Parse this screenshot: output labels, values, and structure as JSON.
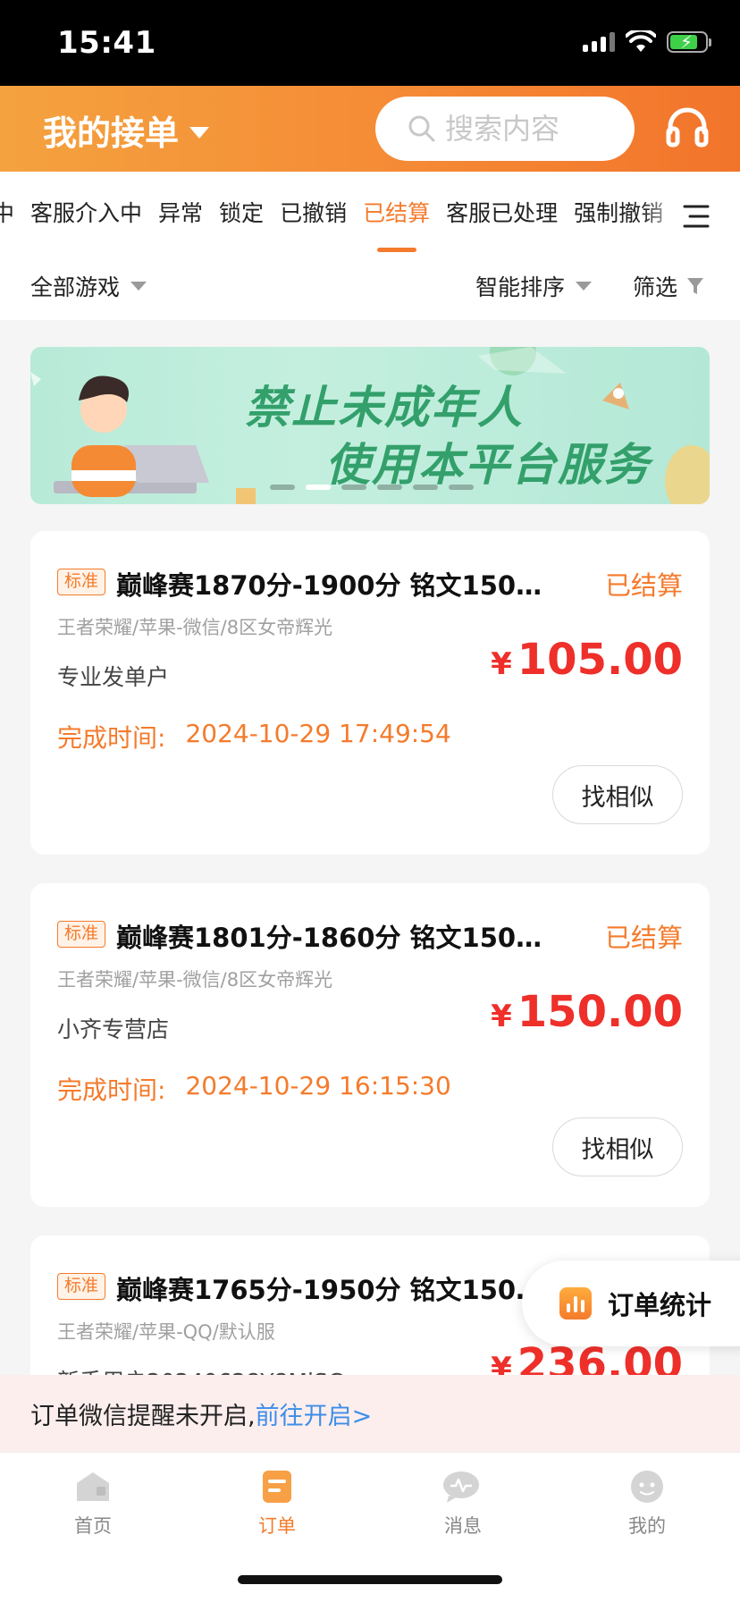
{
  "status_bar": {
    "time": "15:41"
  },
  "header": {
    "title": "我的接单",
    "search_placeholder": "搜索内容",
    "accent_color": "#f47b2c",
    "icons": [
      "chevron-down-icon",
      "search-icon",
      "headset-icon"
    ]
  },
  "tabs": {
    "items": [
      "中",
      "客服介入中",
      "异常",
      "锁定",
      "已撤销",
      "已结算",
      "客服已处理",
      "强制撤销"
    ],
    "active": "已结算"
  },
  "filters": {
    "game": "全部游戏",
    "sort": "智能排序",
    "screen": "筛选"
  },
  "banner": {
    "line1": "禁止未成年人",
    "line2": "使用本平台服务",
    "slide_count": 6,
    "active_slide": 2
  },
  "orders": [
    {
      "tag": "标准",
      "title": "巅峰赛1870分-1900分  铭文150 ...",
      "status": "已结算",
      "sub": "王者荣耀/苹果-微信/8区女帝辉光",
      "shop": "专业发单户",
      "currency": "¥",
      "price": "105.00",
      "finish_label": "完成时间:",
      "finish_time": "2024-10-29 17:49:54",
      "button": "找相似"
    },
    {
      "tag": "标准",
      "title": "巅峰赛1801分-1860分  铭文150 ...",
      "status": "已结算",
      "sub": "王者荣耀/苹果-微信/8区女帝辉光",
      "shop": "小齐专营店",
      "currency": "¥",
      "price": "150.00",
      "finish_label": "完成时间:",
      "finish_time": "2024-10-29 16:15:30",
      "button": "找相似"
    },
    {
      "tag": "标准",
      "title": "巅峰赛1765分-1950分  铭文150 ...",
      "sub": "王者荣耀/苹果-QQ/默认服",
      "shop": "新手用户20240628Y8MiSC",
      "currency": "¥",
      "price": "236.00"
    }
  ],
  "stats_button": {
    "label": "订单统计"
  },
  "notice": {
    "text": "订单微信提醒未开启,",
    "link": "前往开启>"
  },
  "bottom_nav": {
    "items": [
      "首页",
      "订单",
      "消息",
      "我的"
    ],
    "active": "订单"
  }
}
